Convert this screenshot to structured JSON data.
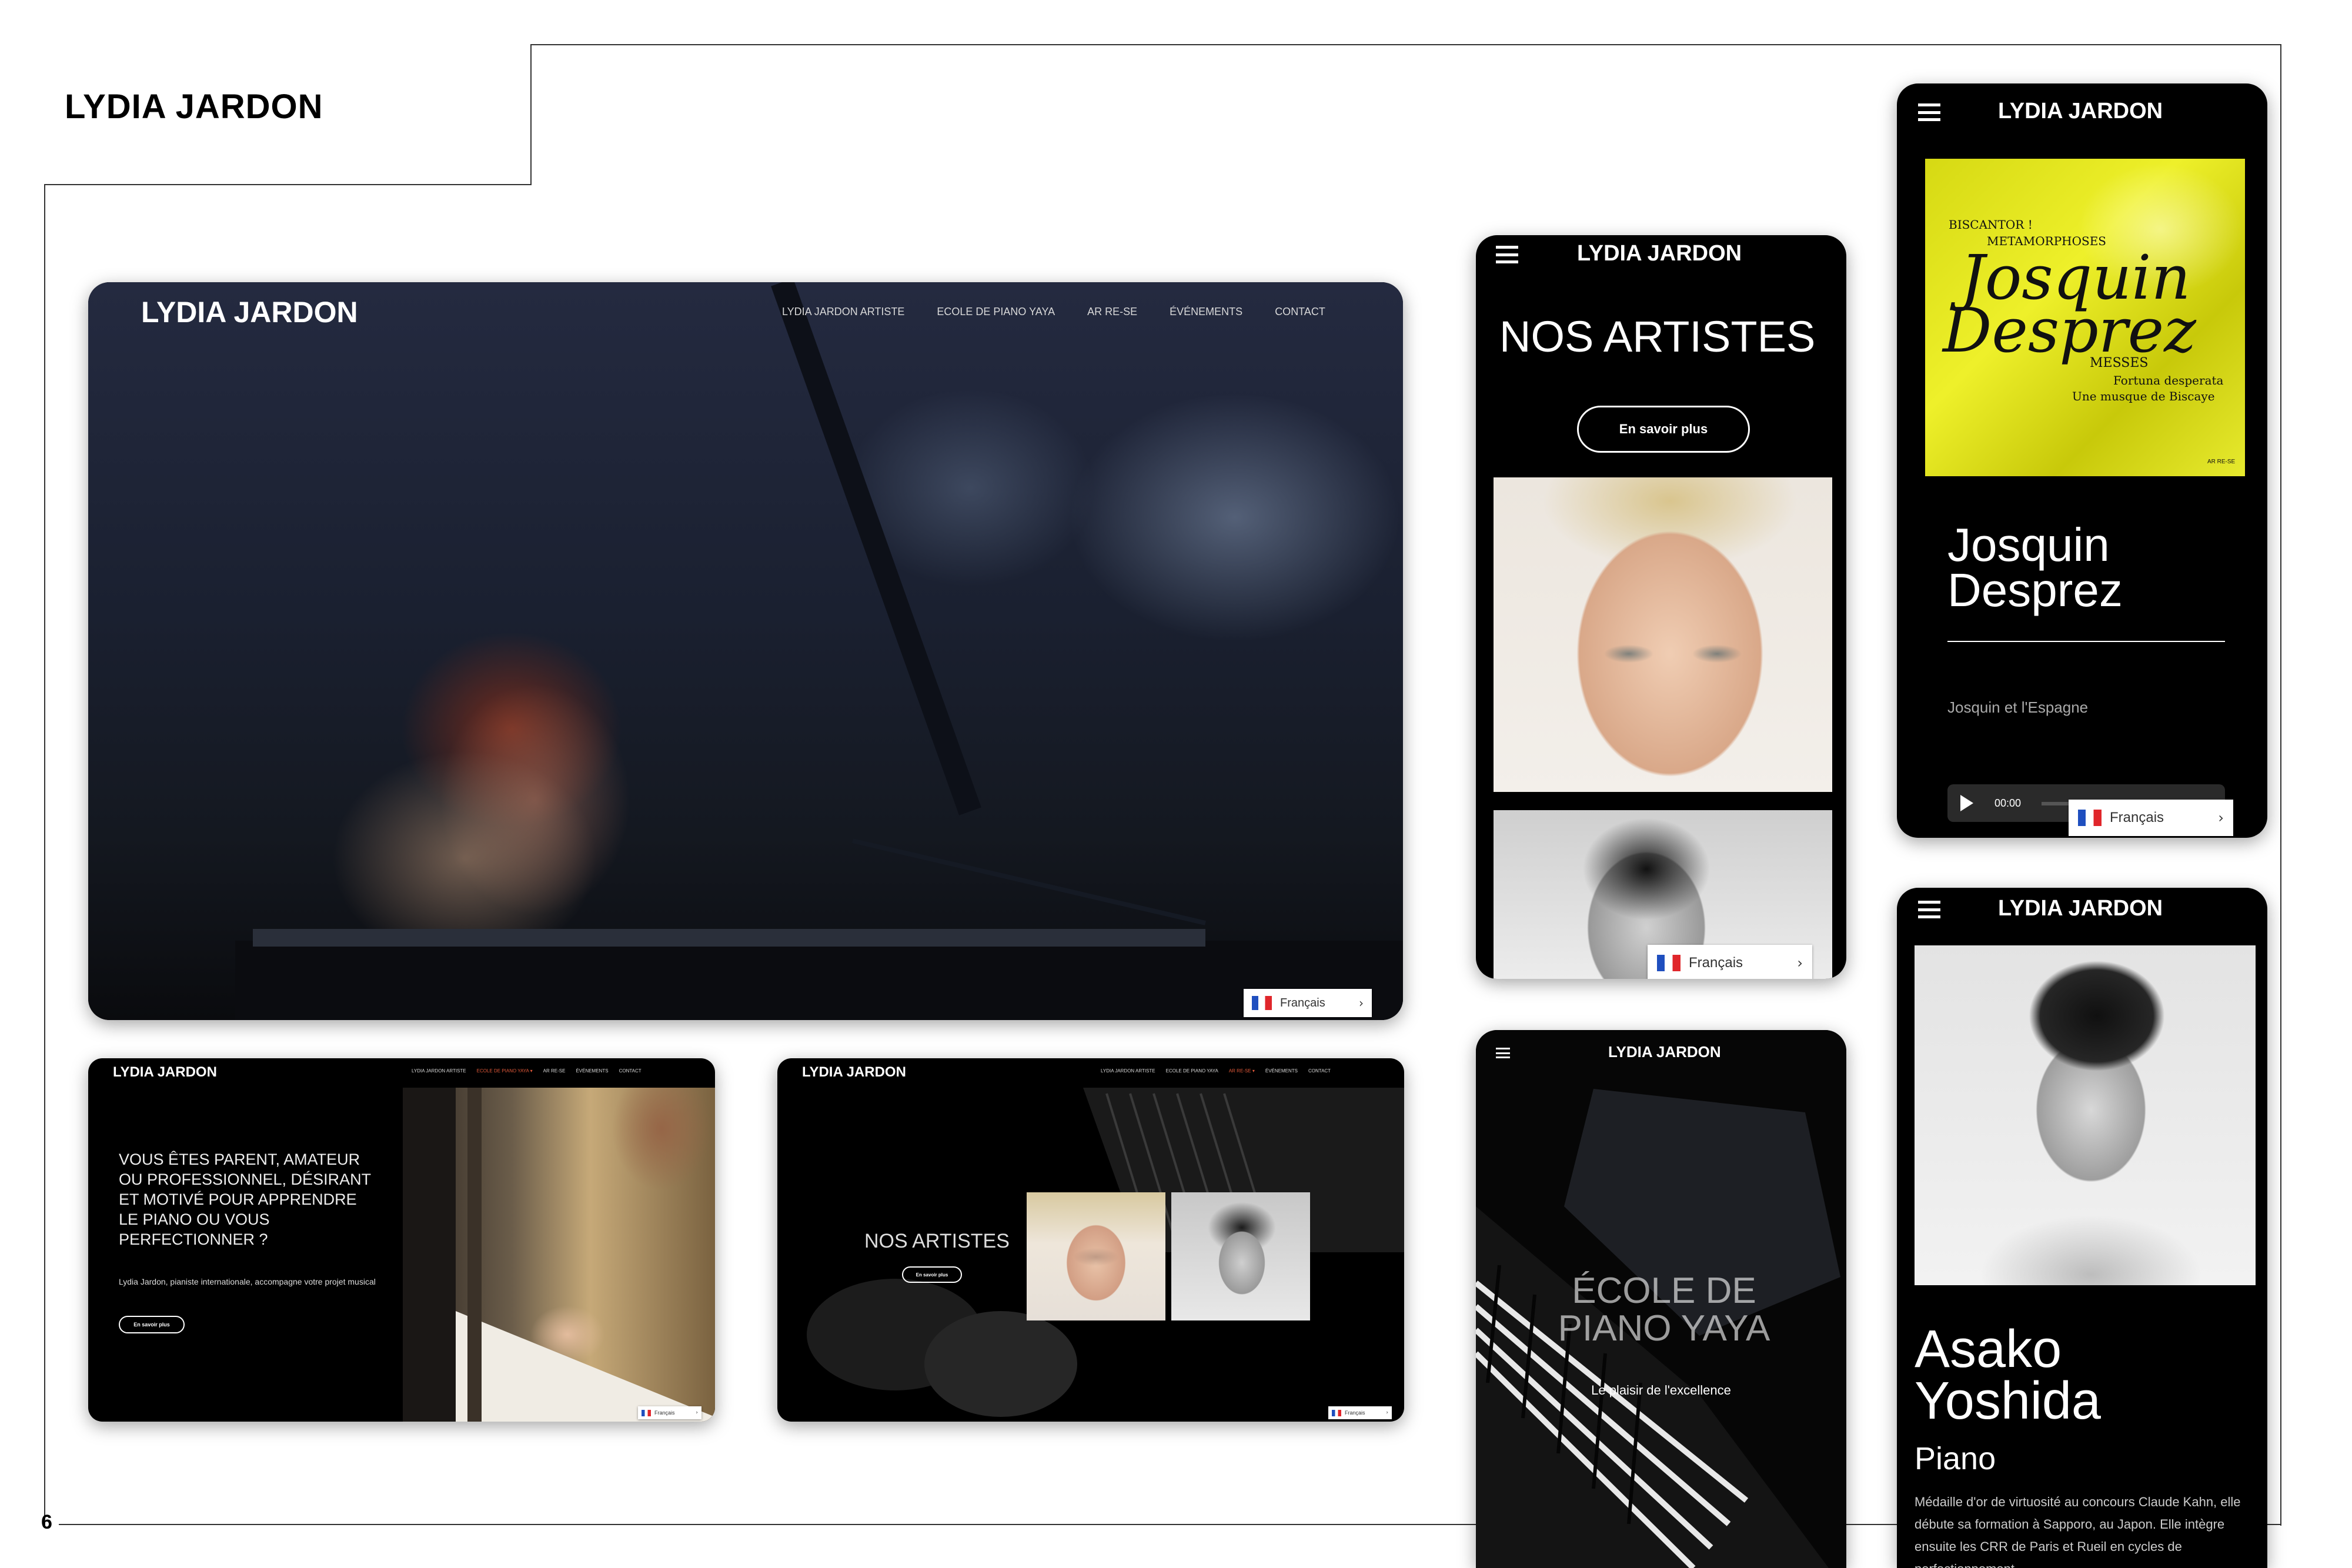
{
  "page": {
    "heading": "LYDIA JARDON",
    "page_number": "6"
  },
  "brand": "LYDIA JARDON",
  "desktop_hero": {
    "nav": [
      "LYDIA JARDON ARTISTE",
      "ECOLE DE PIANO YAYA",
      "AR RE-SE",
      "ÉVÉNEMENTS",
      "CONTACT"
    ],
    "language": "Français"
  },
  "desktop_school": {
    "nav": [
      "LYDIA JARDON ARTISTE",
      "ECOLE DE PIANO YAYA ▾",
      "AR RE-SE",
      "ÉVÉNEMENTS",
      "CONTACT"
    ],
    "headline": "VOUS ÊTES PARENT, AMATEUR OU PROFESSIONNEL, DÉSIRANT ET MOTIVÉ POUR APPRENDRE LE PIANO OU VOUS PERFECTIONNER ?",
    "subtext": "Lydia Jardon, pianiste internationale, accompagne votre projet musical",
    "cta": "En savoir plus",
    "language": "Français"
  },
  "desktop_artists": {
    "nav": [
      "LYDIA JARDON ARTISTE",
      "ECOLE DE PIANO YAYA",
      "AR RE-SE ▾",
      "ÉVÉNEMENTS",
      "CONTACT"
    ],
    "title": "NOS ARTISTES",
    "cta": "En savoir plus",
    "language": "Français"
  },
  "mobile_artists": {
    "title": "NOS ARTISTES",
    "cta": "En savoir plus",
    "language": "Français"
  },
  "mobile_school": {
    "title": "ÉCOLE DE PIANO YAYA",
    "tagline": "Le plaisir de l'excellence"
  },
  "mobile_album": {
    "cover": {
      "label_top": "BISCANTOR !",
      "label_sub": "METAMORPHOSES",
      "name_line1": "Josquin",
      "name_line2": "Desprez",
      "label_messes": "MESSES",
      "line_a": "Fortuna desperata",
      "line_b": "Une musque de Biscaye",
      "logo": "AR RE-SE"
    },
    "title_line1": "Josquin",
    "title_line2": "Desprez",
    "subtitle": "Josquin et l'Espagne",
    "time": "00:00",
    "language": "Français"
  },
  "mobile_profile": {
    "first_name": "Asako",
    "last_name": "Yoshida",
    "instrument": "Piano",
    "bio": "Médaille d'or de virtuosité au concours Claude Kahn, elle débute sa formation à Sapporo, au Japon. Elle intègre ensuite les CRR de Paris et Rueil en cycles de perfectionnement"
  },
  "colors": {
    "background": "#ffffff",
    "card": "#000000",
    "album_yellow": "#e6e619",
    "text_light": "#ffffff"
  }
}
